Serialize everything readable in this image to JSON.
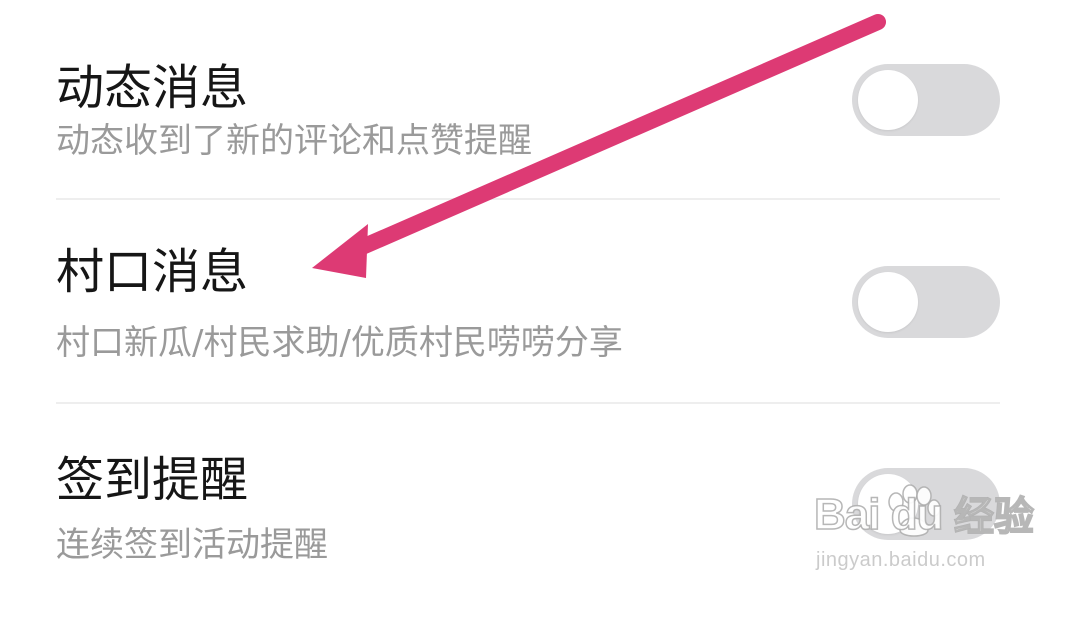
{
  "settings": [
    {
      "title": "动态消息",
      "subtitle": "动态收到了新的评论和点赞提醒",
      "enabled": false
    },
    {
      "title": "村口消息",
      "subtitle": "村口新瓜/村民求助/优质村民唠唠分享",
      "enabled": false
    },
    {
      "title": "签到提醒",
      "subtitle": "连续签到活动提醒",
      "enabled": false
    }
  ],
  "colors": {
    "title": "#161616",
    "subtitle": "#9a9a9a",
    "toggle_off": "#d9d9db",
    "divider": "#eeeeee",
    "annotation_arrow": "#dd3a74"
  },
  "watermark": {
    "logo": "Bai du",
    "brand": "经验",
    "url": "jingyan.baidu.com"
  }
}
